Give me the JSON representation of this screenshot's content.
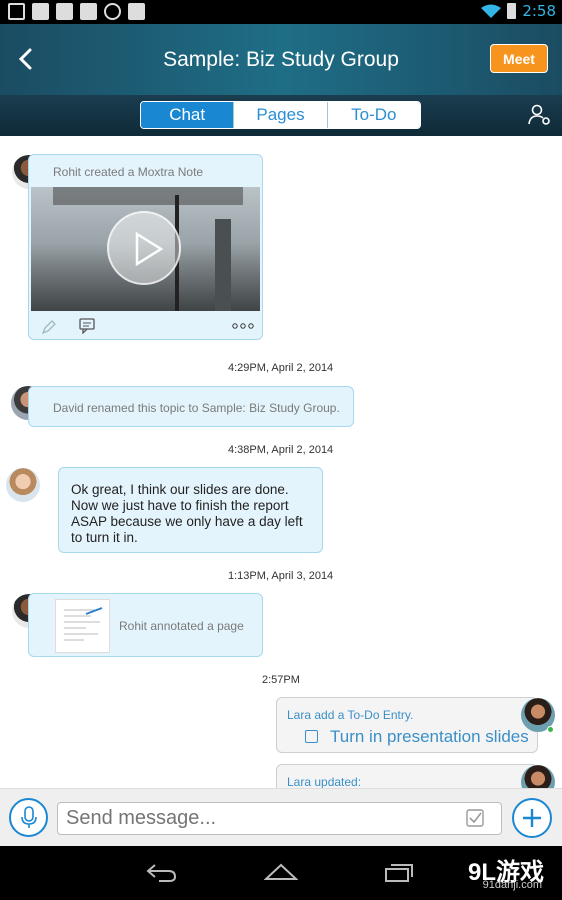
{
  "status_bar": {
    "time": "2:58"
  },
  "header": {
    "title": "Sample: Biz Study Group",
    "meet_label": "Meet"
  },
  "tabs": [
    {
      "label": "Chat",
      "active": true
    },
    {
      "label": "Pages",
      "active": false
    },
    {
      "label": "To-Do",
      "active": false
    }
  ],
  "messages": {
    "note": {
      "caption": "Rohit created a Moxtra Note"
    },
    "ts1": "4:29PM, April 2, 2014",
    "rename": {
      "text": "David renamed this topic to Sample: Biz Study Group."
    },
    "ts2": "4:38PM, April 2, 2014",
    "lara_msg": {
      "text": "Ok great, I think our slides are done. Now we just have to finish the report ASAP because we only have a day left to turn it in."
    },
    "ts3": "1:13PM, April 3, 2014",
    "annot": {
      "text": "Rohit annotated a page"
    },
    "ts4": "2:57PM",
    "todo": {
      "caption": "Lara add a To-Do Entry.",
      "item": "Turn in presentation slides"
    },
    "updated": {
      "caption": "Lara updated:"
    }
  },
  "input": {
    "placeholder": "Send message..."
  },
  "watermark": {
    "main": "9L游戏",
    "sub": "91danji.com"
  },
  "colors": {
    "accent": "#1a87d3",
    "meet": "#f7941d",
    "bubble": "#e4f4fc"
  }
}
